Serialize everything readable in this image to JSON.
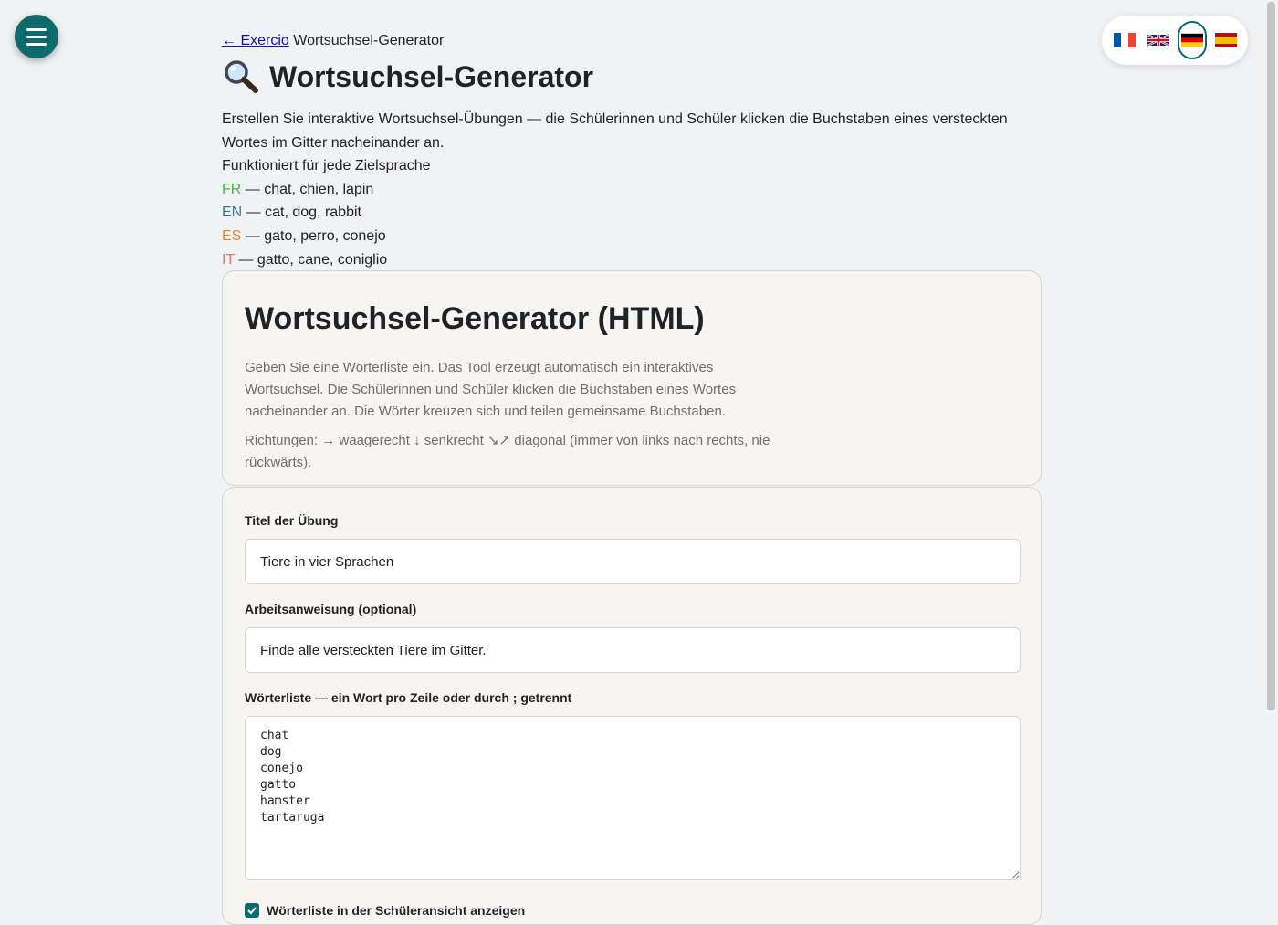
{
  "menu": {
    "icon": "hamburger-icon"
  },
  "languages": [
    {
      "code": "fr",
      "icon": "flag-fr-icon",
      "active": false
    },
    {
      "code": "en",
      "icon": "flag-uk-icon",
      "active": false
    },
    {
      "code": "de",
      "icon": "flag-de-icon",
      "active": true
    },
    {
      "code": "es",
      "icon": "flag-es-icon",
      "active": false
    }
  ],
  "breadcrumb": {
    "back_link": "← Exercio",
    "current": "Wortsuchsel-Generator"
  },
  "page": {
    "title": "Wortsuchsel-Generator",
    "title_icon": "magnifier-icon",
    "intro": "Erstellen Sie interaktive Wortsuchsel-Übungen — die Schülerinnen und Schüler klicken die Buchstaben eines versteckten Wortes im Gitter nacheinander an.",
    "works_for": "Funktioniert für jede Zielsprache",
    "examples": [
      {
        "code": "FR",
        "text": " — chat, chien, lapin"
      },
      {
        "code": "EN",
        "text": " — cat, dog, rabbit"
      },
      {
        "code": "ES",
        "text": " — gato, perro, conejo"
      },
      {
        "code": "IT",
        "text": " — gatto, cane, coniglio"
      }
    ]
  },
  "info_card": {
    "title": "Wortsuchsel-Generator (HTML)",
    "description": "Geben Sie eine Wörterliste ein. Das Tool erzeugt automatisch ein interaktives Wortsuchsel. Die Schülerinnen und Schüler klicken die Buchstaben eines Wortes nacheinander an. Die Wörter kreuzen sich und teilen gemeinsame Buchstaben.",
    "directions": "Richtungen: → waagerecht ↓ senkrecht ↘↗ diagonal (immer von links nach rechts, nie rückwärts)."
  },
  "form": {
    "title_label": "Titel der Übung",
    "title_value": "Tiere in vier Sprachen",
    "instruction_label": "Arbeitsanweisung (optional)",
    "instruction_value": "Finde alle versteckten Tiere im Gitter.",
    "wordlist_label": "Wörterliste — ein Wort pro Zeile oder durch ; getrennt",
    "wordlist_value": "chat\ndog\nconejo\ngatto\nhamster\ntartaruga",
    "show_list_label": "Wörterliste in der Schüleransicht anzeigen",
    "show_list_checked": true
  },
  "colors": {
    "accent": "#0d6b6b",
    "card_bg": "#f6f5f2",
    "page_bg": "#f1f2f4"
  }
}
